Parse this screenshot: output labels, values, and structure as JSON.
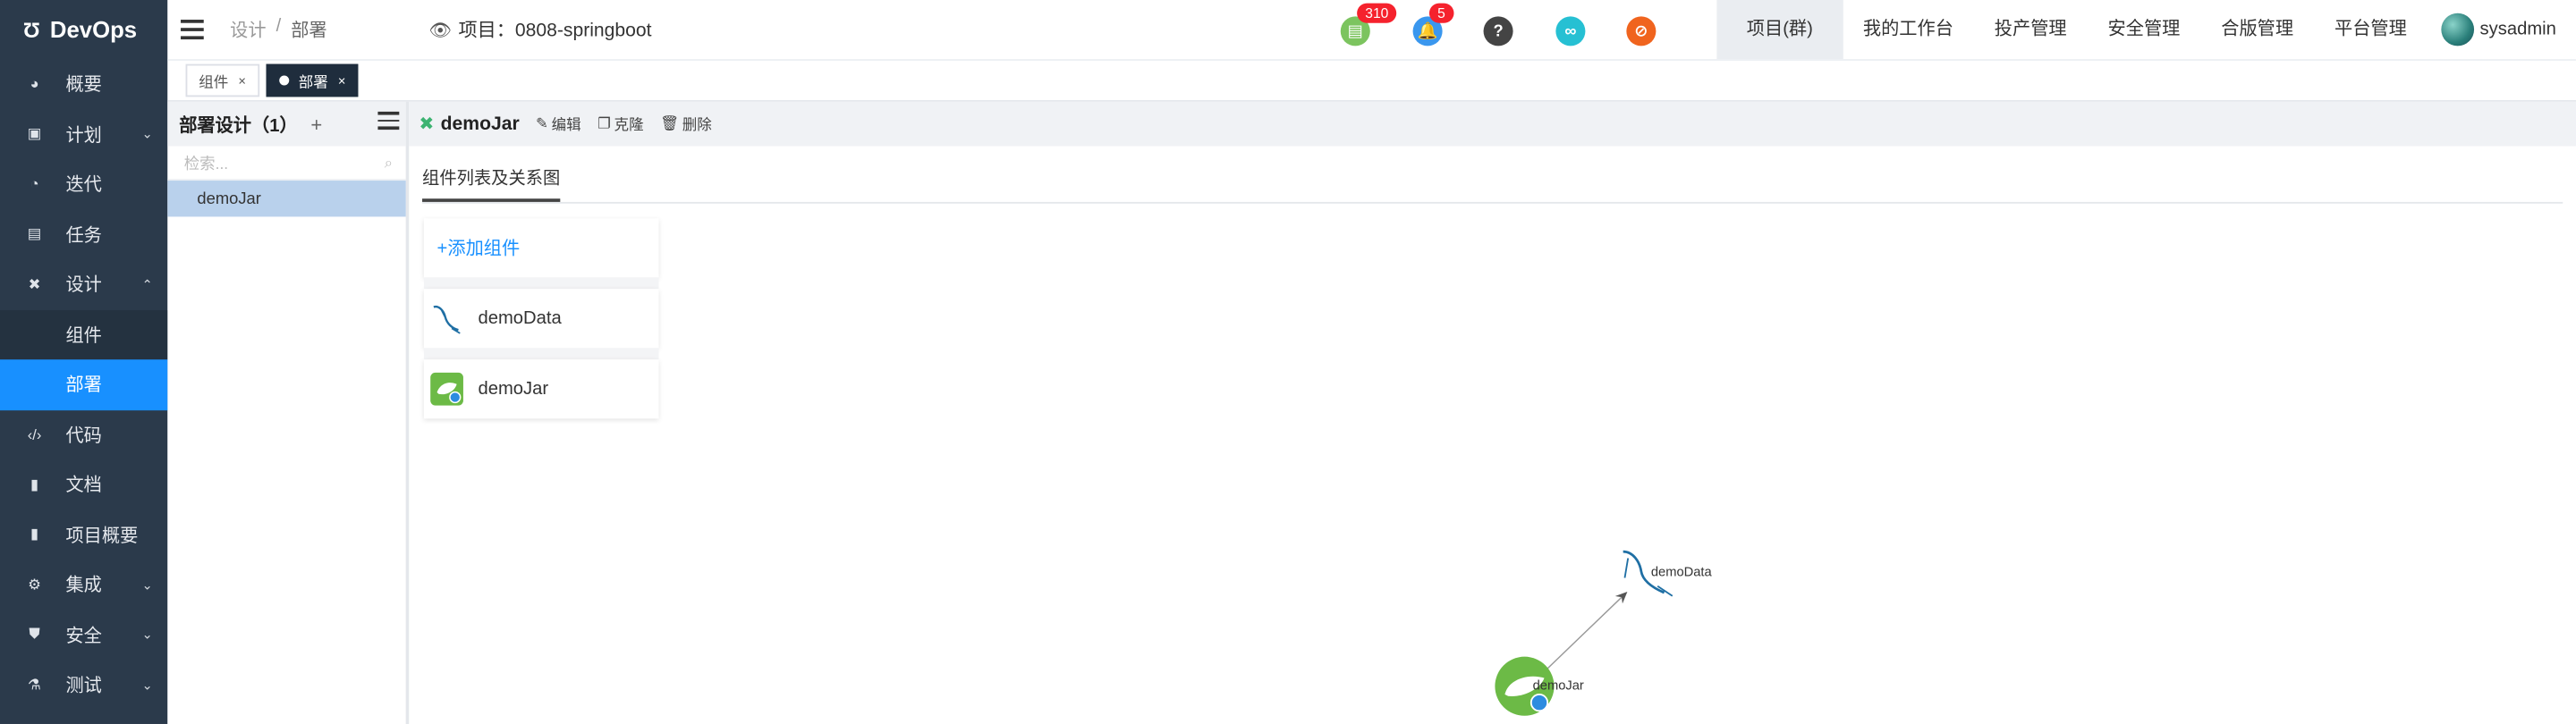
{
  "sidebar": {
    "brand": "DevOps",
    "items": [
      {
        "label": "概要",
        "icon": "dashboard-icon"
      },
      {
        "label": "计划",
        "icon": "calendar-icon",
        "chevron": "down"
      },
      {
        "label": "迭代",
        "icon": "iteration-icon"
      },
      {
        "label": "任务",
        "icon": "task-icon"
      },
      {
        "label": "设计",
        "icon": "design-icon",
        "chevron": "up"
      },
      {
        "label": "组件",
        "sub": true
      },
      {
        "label": "部署",
        "sub": true,
        "active": true
      },
      {
        "label": "代码",
        "icon": "code-icon"
      },
      {
        "label": "文档",
        "icon": "document-icon"
      },
      {
        "label": "项目概要",
        "icon": "summary-icon"
      },
      {
        "label": "集成",
        "icon": "integration-icon",
        "chevron": "down"
      },
      {
        "label": "安全",
        "icon": "shield-icon",
        "chevron": "down"
      },
      {
        "label": "测试",
        "icon": "flask-icon",
        "chevron": "down"
      }
    ]
  },
  "header": {
    "breadcrumb": [
      "设计",
      "部署"
    ],
    "project_label": "项目：0808-springboot",
    "badges": {
      "tasks": "310",
      "notifications": "5"
    },
    "nav": [
      "项目(群)",
      "我的工作台",
      "投产管理",
      "安全管理",
      "合版管理",
      "平台管理"
    ],
    "user": "sysadmin"
  },
  "tabs": [
    {
      "label": "组件",
      "active": false
    },
    {
      "label": "部署",
      "active": true
    }
  ],
  "leftpanel": {
    "title": "部署设计（1）",
    "search_placeholder": "检索...",
    "items": [
      "demoJar"
    ]
  },
  "main": {
    "title": "demoJar",
    "actions": [
      "编辑",
      "克隆",
      "删除"
    ],
    "tab": "组件列表及关系图",
    "add_component": "+添加组件",
    "components": [
      {
        "name": "demoData",
        "icon": "mysql-icon"
      },
      {
        "name": "demoJar",
        "icon": "springboot-icon"
      }
    ]
  },
  "graph": {
    "nodes": [
      {
        "label": "demoData",
        "icon": "mysql-icon"
      },
      {
        "label": "demoJar",
        "icon": "springboot-icon"
      }
    ],
    "edge": {
      "from": "demoJar",
      "to": "demoData"
    }
  },
  "colors": {
    "sidebar_bg": "#2b3a4b",
    "active_blue": "#1890ff",
    "badge_red": "#f5222d",
    "spring_green": "#6cba46",
    "mysql_blue": "#1f6fa4"
  }
}
